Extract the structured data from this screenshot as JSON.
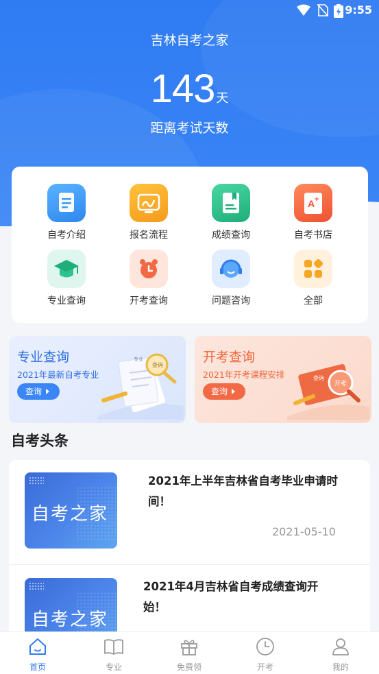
{
  "status_bar": {
    "time": "9:55"
  },
  "header": {
    "app_title": "吉林自考之家",
    "days_value": "143",
    "days_unit": "天",
    "days_label": "距离考试天数"
  },
  "grid": {
    "items": [
      {
        "label": "自考介绍",
        "icon": "intro-doc-icon",
        "color": "#3b9bf2"
      },
      {
        "label": "报名流程",
        "icon": "signup-process-icon",
        "color": "#f6a623"
      },
      {
        "label": "成绩查询",
        "icon": "score-query-icon",
        "color": "#2cc38f"
      },
      {
        "label": "自考书店",
        "icon": "bookstore-icon",
        "color": "#f26a45"
      },
      {
        "label": "专业查询",
        "icon": "graduation-cap-icon",
        "color": "#2cc38f"
      },
      {
        "label": "开考查询",
        "icon": "alarm-clock-icon",
        "color": "#f26a45"
      },
      {
        "label": "问题咨询",
        "icon": "headset-icon",
        "color": "#3b9bf2"
      },
      {
        "label": "全部",
        "icon": "all-apps-icon",
        "color": "#f6a623"
      }
    ]
  },
  "promos": [
    {
      "title": "专业查询",
      "subtitle": "2021年最新自考专业",
      "button": "查询",
      "accent": "#2f7bf2"
    },
    {
      "title": "开考查询",
      "subtitle": "2021年开考课程安排",
      "button": "查询",
      "accent": "#f0653b"
    }
  ],
  "promo_art": {
    "left_sheet_tag": "专业",
    "left_lens_tag": "查询",
    "right_board_tag": "查询",
    "right_lens_tag": "开考"
  },
  "news": {
    "section_title": "自考头条",
    "thumb_text": "自考之家",
    "items": [
      {
        "title_line1": "2021年上半年吉林省自考毕业申请时",
        "title_line2": "间！",
        "date": "2021-05-10"
      },
      {
        "title_line1": "2021年4月吉林省自考成绩查询开",
        "title_line2": "始！",
        "date": ""
      }
    ]
  },
  "tabbar": {
    "tabs": [
      {
        "label": "首页",
        "icon": "home-icon",
        "active": true
      },
      {
        "label": "专业",
        "icon": "book-icon",
        "active": false
      },
      {
        "label": "免费领",
        "icon": "gift-icon",
        "active": false
      },
      {
        "label": "开考",
        "icon": "clock-icon",
        "active": false
      },
      {
        "label": "我的",
        "icon": "user-icon",
        "active": false
      }
    ]
  },
  "colors": {
    "primary": "#2f7bf2",
    "orange": "#f0653b",
    "background": "#f3f5f8"
  }
}
